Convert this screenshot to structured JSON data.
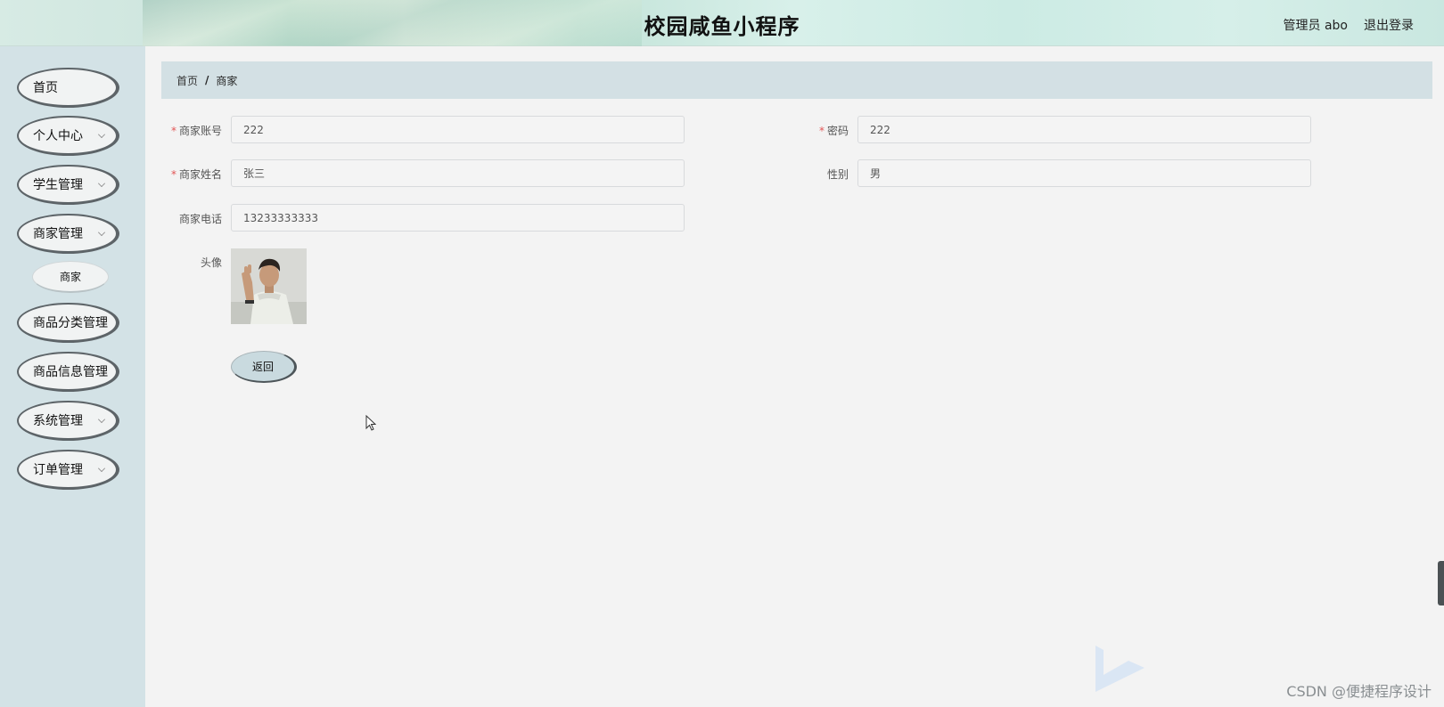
{
  "header": {
    "title": "校园咸鱼小程序",
    "user": "管理员 abo",
    "logout_label": "退出登录"
  },
  "sidebar": {
    "items": [
      {
        "label": "首页",
        "has_arrow": false
      },
      {
        "label": "个人中心",
        "has_arrow": true
      },
      {
        "label": "学生管理",
        "has_arrow": true
      },
      {
        "label": "商家管理",
        "has_arrow": true
      },
      {
        "label": "商品分类管理",
        "has_arrow": false
      },
      {
        "label": "商品信息管理",
        "has_arrow": false
      },
      {
        "label": "系统管理",
        "has_arrow": true
      },
      {
        "label": "订单管理",
        "has_arrow": true
      }
    ],
    "sub_items": [
      {
        "label": "商家"
      }
    ]
  },
  "breadcrumb": {
    "home": "首页",
    "separator": "/",
    "current": "商家"
  },
  "form": {
    "account": {
      "label": "商家账号",
      "value": "222",
      "required": true
    },
    "password": {
      "label": "密码",
      "value": "222",
      "required": true
    },
    "name": {
      "label": "商家姓名",
      "value": "张三",
      "required": true
    },
    "gender": {
      "label": "性别",
      "value": "男",
      "required": false
    },
    "phone": {
      "label": "商家电话",
      "value": "13233333333",
      "required": false
    },
    "avatar": {
      "label": "头像"
    },
    "back_label": "返回",
    "required_mark": "*"
  },
  "watermark": "CSDN @便捷程序设计",
  "colors": {
    "sidebar_bg": "#d3e2e6",
    "breadcrumb_bg": "#d3e0e4",
    "page_bg": "#f3f3f3",
    "required": "#e25555"
  }
}
